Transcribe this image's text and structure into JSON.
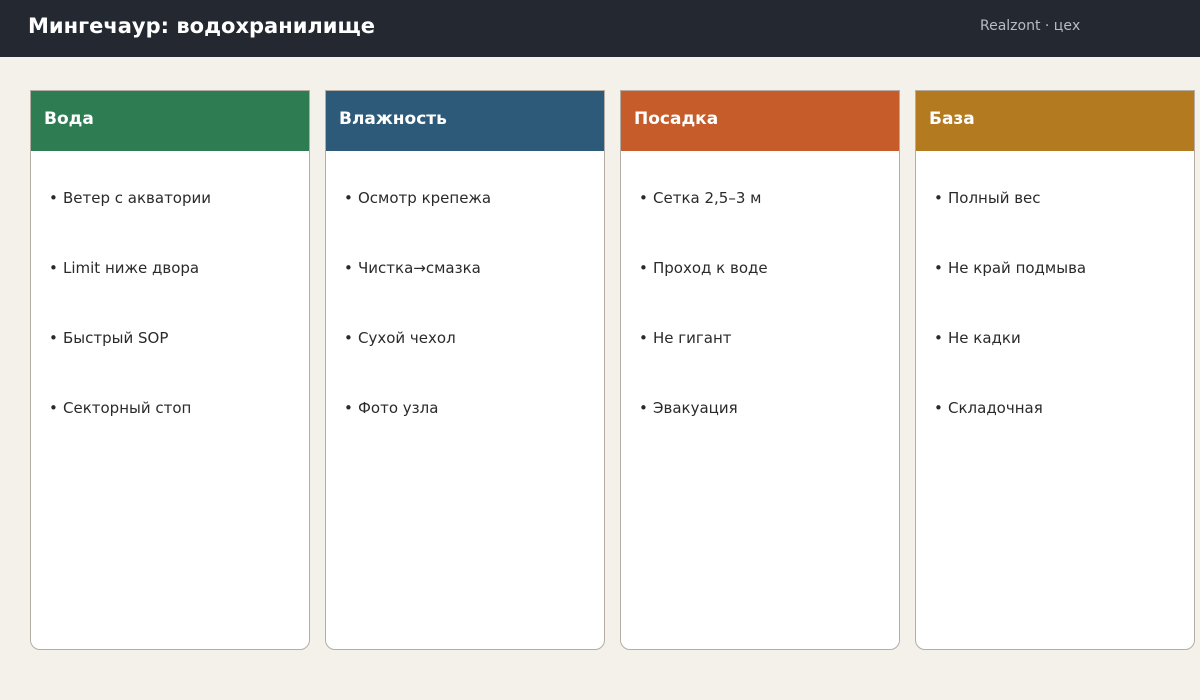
{
  "header": {
    "title": "Мингечаур: водохранилище",
    "brand": "Realzont · цех"
  },
  "bullet": "•",
  "columns": [
    {
      "title": "Вода",
      "color": "#2e7d52",
      "items": [
        "Ветер с акватории",
        "Limit ниже двора",
        "Быстрый SOP",
        "Секторный стоп"
      ]
    },
    {
      "title": "Влажность",
      "color": "#2e5a7a",
      "items": [
        "Осмотр крепежа",
        "Чистка→смазка",
        "Сухой чехол",
        "Фото узла"
      ]
    },
    {
      "title": "Посадка",
      "color": "#c55c2a",
      "items": [
        "Сетка 2,5–3 м",
        "Проход к воде",
        "Не гигант",
        "Эвакуация"
      ]
    },
    {
      "title": "База",
      "color": "#b47a20",
      "items": [
        "Полный вес",
        "Не край подмыва",
        "Не кадки",
        "Складочная"
      ]
    }
  ]
}
